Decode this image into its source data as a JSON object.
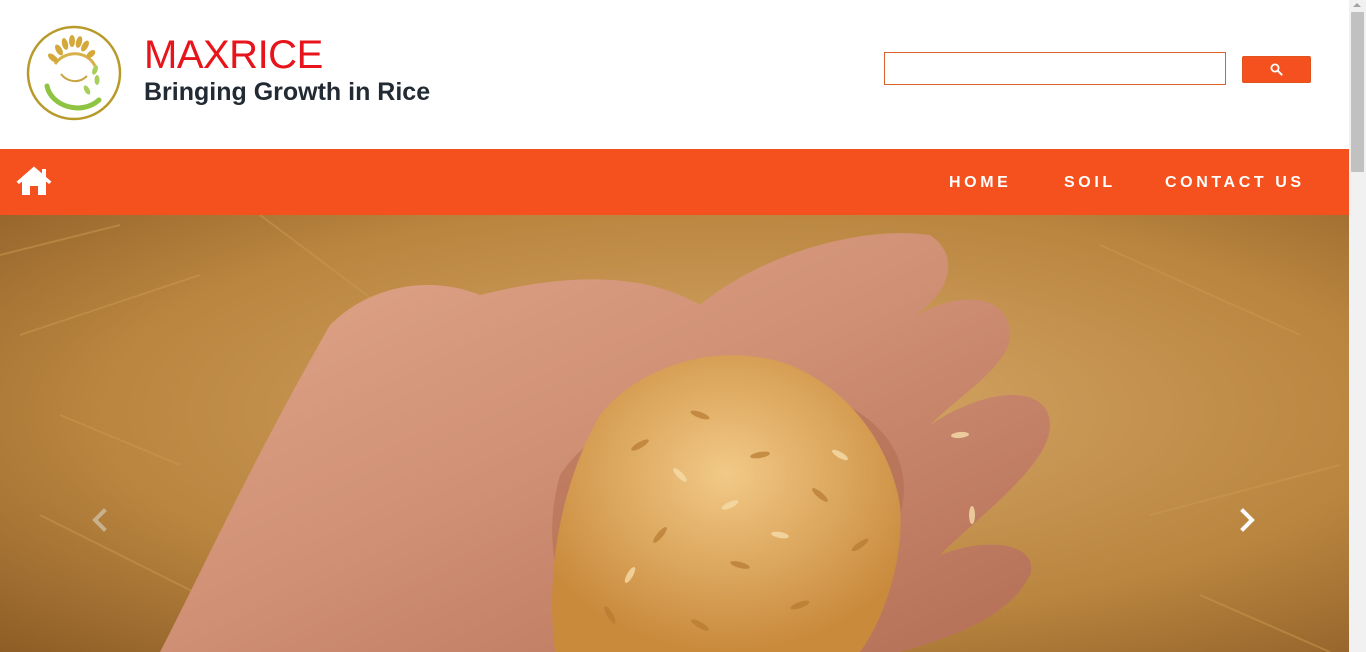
{
  "header": {
    "brand_title": "MAXRICE",
    "tagline": "Bringing Growth in Rice",
    "logo_icon": "rice-wreath-logo",
    "search": {
      "value": "",
      "placeholder": "",
      "button_icon": "search-icon"
    }
  },
  "nav": {
    "home_icon": "home-icon",
    "links": [
      {
        "label": "HOME"
      },
      {
        "label": "SOIL"
      },
      {
        "label": "CONTACT US"
      }
    ]
  },
  "carousel": {
    "image": "hand-holding-rice-grains",
    "prev_icon": "chevron-left-icon",
    "next_icon": "chevron-right-icon"
  },
  "colors": {
    "brand_red": "#e8141b",
    "nav_orange": "#f4511e",
    "tagline_dark": "#222a33"
  }
}
